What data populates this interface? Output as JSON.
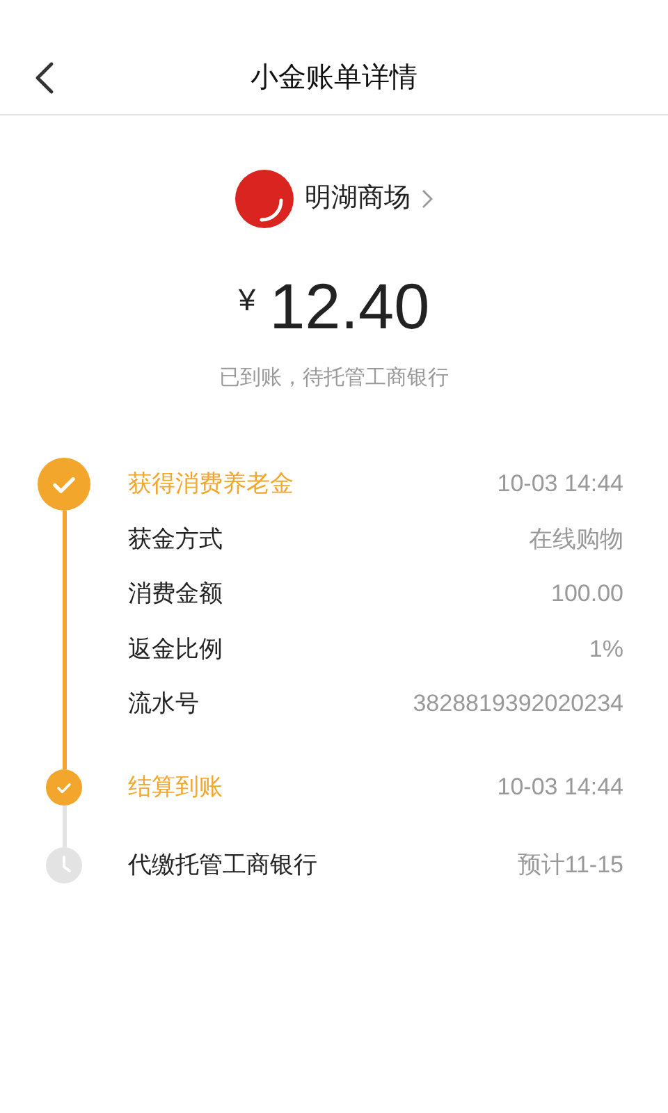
{
  "header": {
    "title": "小金账单详情"
  },
  "merchant": {
    "name": "明湖商场"
  },
  "amount": {
    "currency": "¥",
    "value": "12.40"
  },
  "status_text": "已到账，待托管工商银行",
  "steps": [
    {
      "kind": "major",
      "done": true,
      "title": "获得消费养老金",
      "time": "10-03 14:44",
      "details": [
        {
          "label": "获金方式",
          "value": "在线购物"
        },
        {
          "label": "消费金额",
          "value": "100.00"
        },
        {
          "label": "返金比例",
          "value": "1%"
        },
        {
          "label": "流水号",
          "value": "3828819392020234"
        }
      ]
    },
    {
      "kind": "minor",
      "done": true,
      "title": "结算到账",
      "time": "10-03 14:44"
    },
    {
      "kind": "minor",
      "done": false,
      "title": "代缴托管工商银行",
      "time": "预计11-15"
    }
  ]
}
